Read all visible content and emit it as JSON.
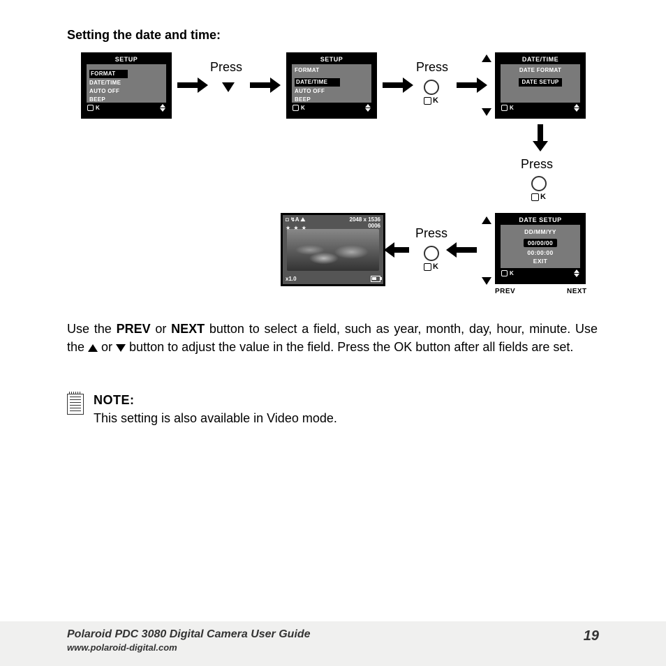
{
  "title": "Setting the date and time:",
  "screens": {
    "setup1": {
      "header": "SETUP",
      "items": [
        "FORMAT",
        "DATE/TIME",
        "AUTO OFF",
        "BEEP"
      ],
      "selected": 0,
      "ok": "K"
    },
    "setup2": {
      "header": "SETUP",
      "items": [
        "FORMAT",
        "DATE/TIME",
        "AUTO OFF",
        "BEEP"
      ],
      "selected": 1,
      "ok": "K"
    },
    "datetime": {
      "header": "DATE/TIME",
      "items": [
        "DATE FORMAT",
        "DATE SETUP"
      ],
      "selected": 1,
      "ok": "K"
    },
    "datesetup": {
      "header": "DATE SETUP",
      "lines": [
        "DD/MM/YY",
        "00/00/00",
        "00:00:00",
        "EXIT"
      ],
      "inverted": 1,
      "ok": "K",
      "prev": "PREV",
      "next": "NEXT"
    },
    "preview": {
      "icons_row": "◘ ↯A ⛰",
      "resolution": "2048 x 1536",
      "count": "0006",
      "stars": "★ ★ ★",
      "zoom": "x1.0"
    }
  },
  "labels": {
    "press": "Press",
    "ok": "K"
  },
  "instructions": {
    "part1": "Use the ",
    "prev": "PREV",
    "part2": " or ",
    "next": "NEXT",
    "part3": " button to select a field, such as year, month, day, hour, minute. Use the ",
    "part4": " or ",
    "part5": " button to adjust the value in the field. Press the OK button after all fields are set."
  },
  "note": {
    "label": "NOTE:",
    "text": "This setting is also available in Video mode."
  },
  "footer": {
    "title": "Polaroid PDC 3080 Digital Camera User Guide",
    "url": "www.polaroid-digital.com",
    "page": "19"
  }
}
